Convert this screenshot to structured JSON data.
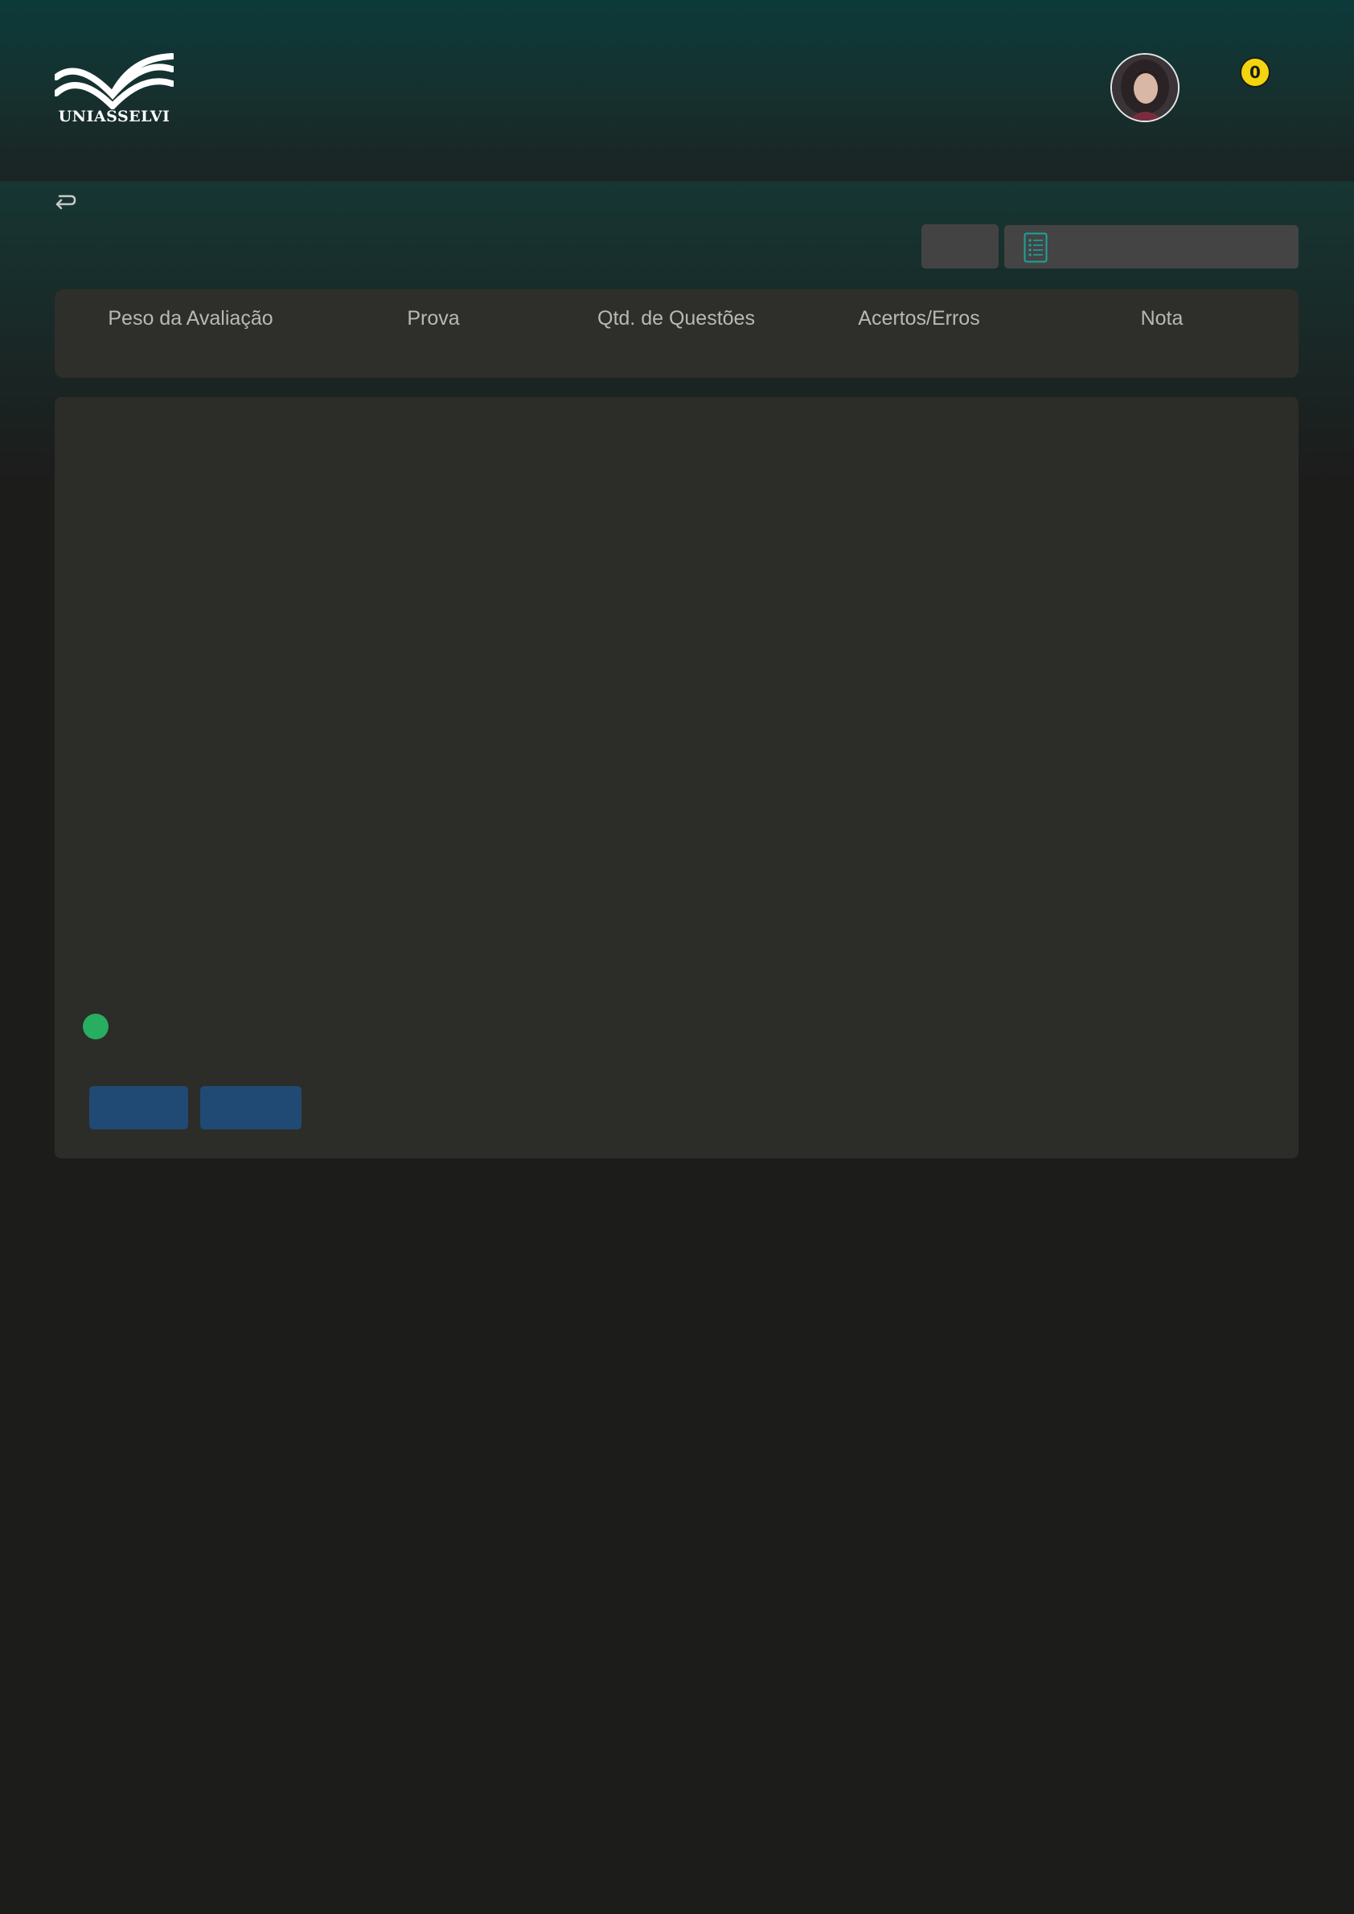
{
  "header": {
    "logo_text": "UNIASSELVI",
    "notification_count": "0"
  },
  "summary": {
    "columns": [
      "Peso da Avaliação",
      "Prova",
      "Qtd. de Questões",
      "Acertos/Erros",
      "Nota"
    ]
  },
  "icons": {
    "back": "return-arrow-icon",
    "select": "list-icon"
  },
  "colors": {
    "accent_teal": "#1ba39c",
    "badge_yellow": "#f2d40f",
    "status_green": "#27ae60",
    "button_blue": "#204a73"
  }
}
